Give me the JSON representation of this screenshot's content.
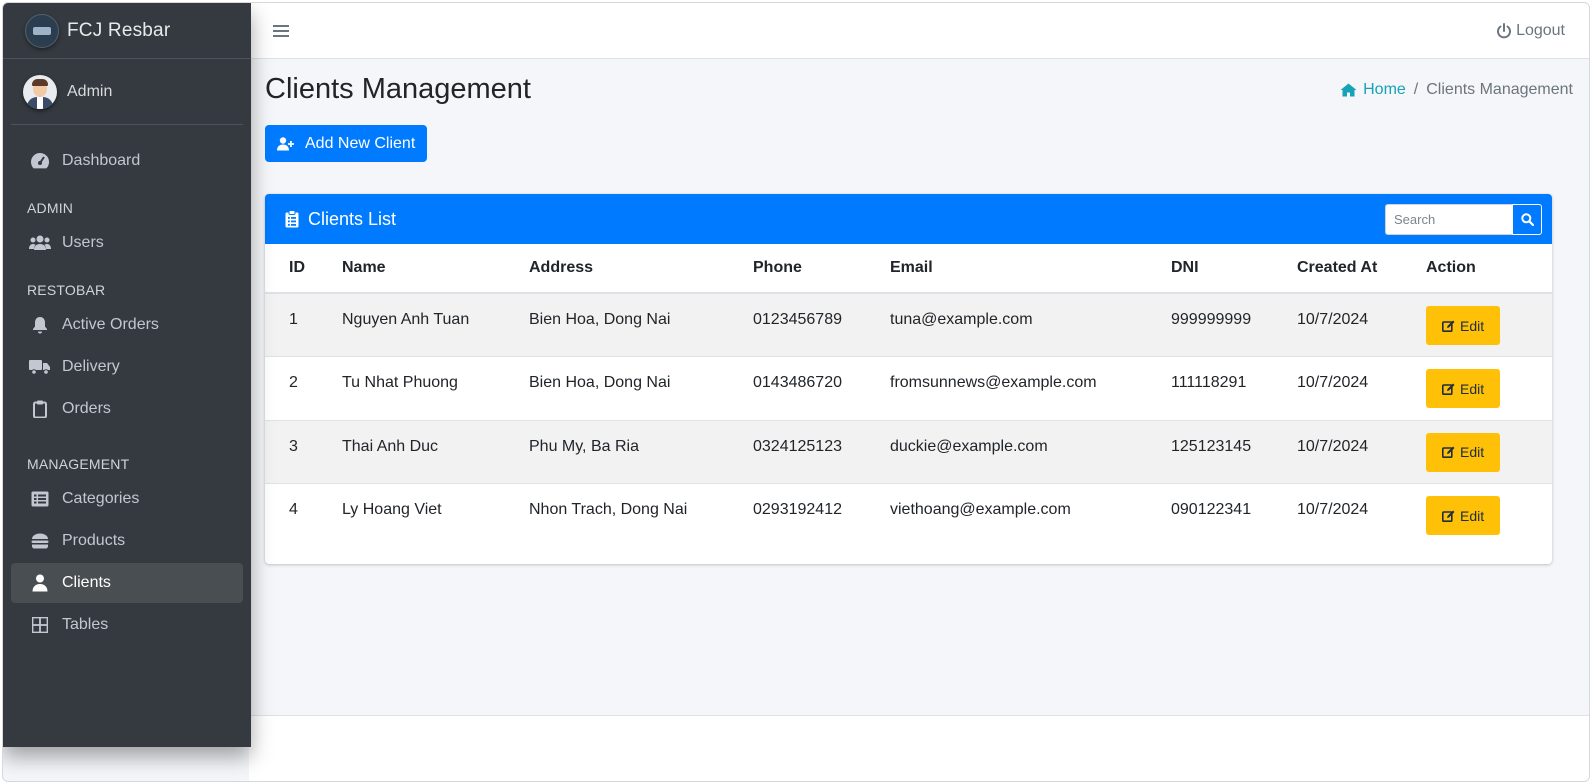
{
  "brand": {
    "name": "FCJ Resbar"
  },
  "user": {
    "name": "Admin"
  },
  "sidebar": {
    "items": [
      {
        "label": "Dashboard"
      },
      {
        "header": "ADMIN"
      },
      {
        "label": "Users"
      },
      {
        "header": "RESTOBAR"
      },
      {
        "label": "Active Orders"
      },
      {
        "label": "Delivery"
      },
      {
        "label": "Orders"
      },
      {
        "header": "MANAGEMENT"
      },
      {
        "label": "Categories"
      },
      {
        "label": "Products"
      },
      {
        "label": "Clients",
        "active": true
      },
      {
        "label": "Tables"
      }
    ]
  },
  "topbar": {
    "logout_label": "Logout"
  },
  "page": {
    "title": "Clients Management",
    "breadcrumb_home": "Home",
    "breadcrumb_current": "Clients Management",
    "add_button_label": "Add New Client"
  },
  "card": {
    "title": "Clients List",
    "search_placeholder": "Search"
  },
  "table": {
    "columns": [
      "ID",
      "Name",
      "Address",
      "Phone",
      "Email",
      "DNI",
      "Created At",
      "Action"
    ],
    "rows": [
      [
        "1",
        "Nguyen Anh Tuan",
        "Bien Hoa, Dong Nai",
        "0123456789",
        "tuna@example.com",
        "999999999",
        "10/7/2024"
      ],
      [
        "2",
        "Tu Nhat Phuong",
        "Bien Hoa, Dong Nai",
        "0143486720",
        "fromsunnews@example.com",
        "111118291",
        "10/7/2024"
      ],
      [
        "3",
        "Thai Anh Duc",
        "Phu My, Ba Ria",
        "0324125123",
        "duckie@example.com",
        "125123145",
        "10/7/2024"
      ],
      [
        "4",
        "Ly Hoang Viet",
        "Nhon Trach, Dong Nai",
        "0293192412",
        "viethoang@example.com",
        "090122341",
        "10/7/2024"
      ]
    ],
    "edit_label": "Edit"
  },
  "colors": {
    "sidebar_bg": "#343a40",
    "primary": "#007bff",
    "warning": "#ffc107",
    "info": "#17a2b8"
  }
}
